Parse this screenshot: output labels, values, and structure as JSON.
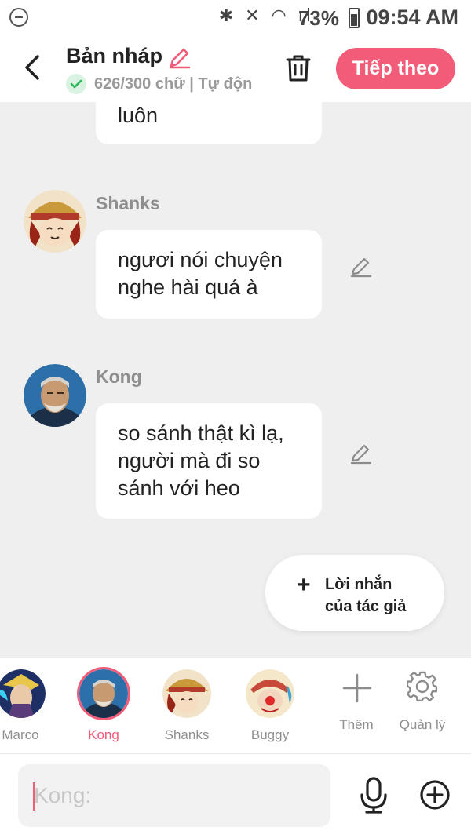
{
  "status_bar": {
    "battery_pct": "73%",
    "time": "09:54 AM",
    "icons": "✱ ✕ ◠ ıl"
  },
  "header": {
    "title": "Bản nháp",
    "subtitle": "626/300 chữ | Tự độn",
    "next_label": "Tiếp theo"
  },
  "messages": [
    {
      "sender": "",
      "text": "luôn"
    },
    {
      "sender": "Shanks",
      "text": "ngươi nói chuyện nghe hài quá à"
    },
    {
      "sender": "Kong",
      "text": "so sánh thật kì lạ, người mà đi so sánh với heo"
    }
  ],
  "author_note": {
    "plus": "+",
    "label_line1": "Lời nhắn",
    "label_line2": "của tác giả"
  },
  "characters": [
    {
      "name": "Marco"
    },
    {
      "name": "Kong",
      "selected": true
    },
    {
      "name": "Shanks"
    },
    {
      "name": "Buggy"
    }
  ],
  "tools": {
    "add_label": "Thêm",
    "manage_label": "Quản lý"
  },
  "input": {
    "placeholder": "Kong:"
  },
  "colors": {
    "accent": "#f25c78",
    "background": "#efefef",
    "bubble": "#ffffff"
  }
}
